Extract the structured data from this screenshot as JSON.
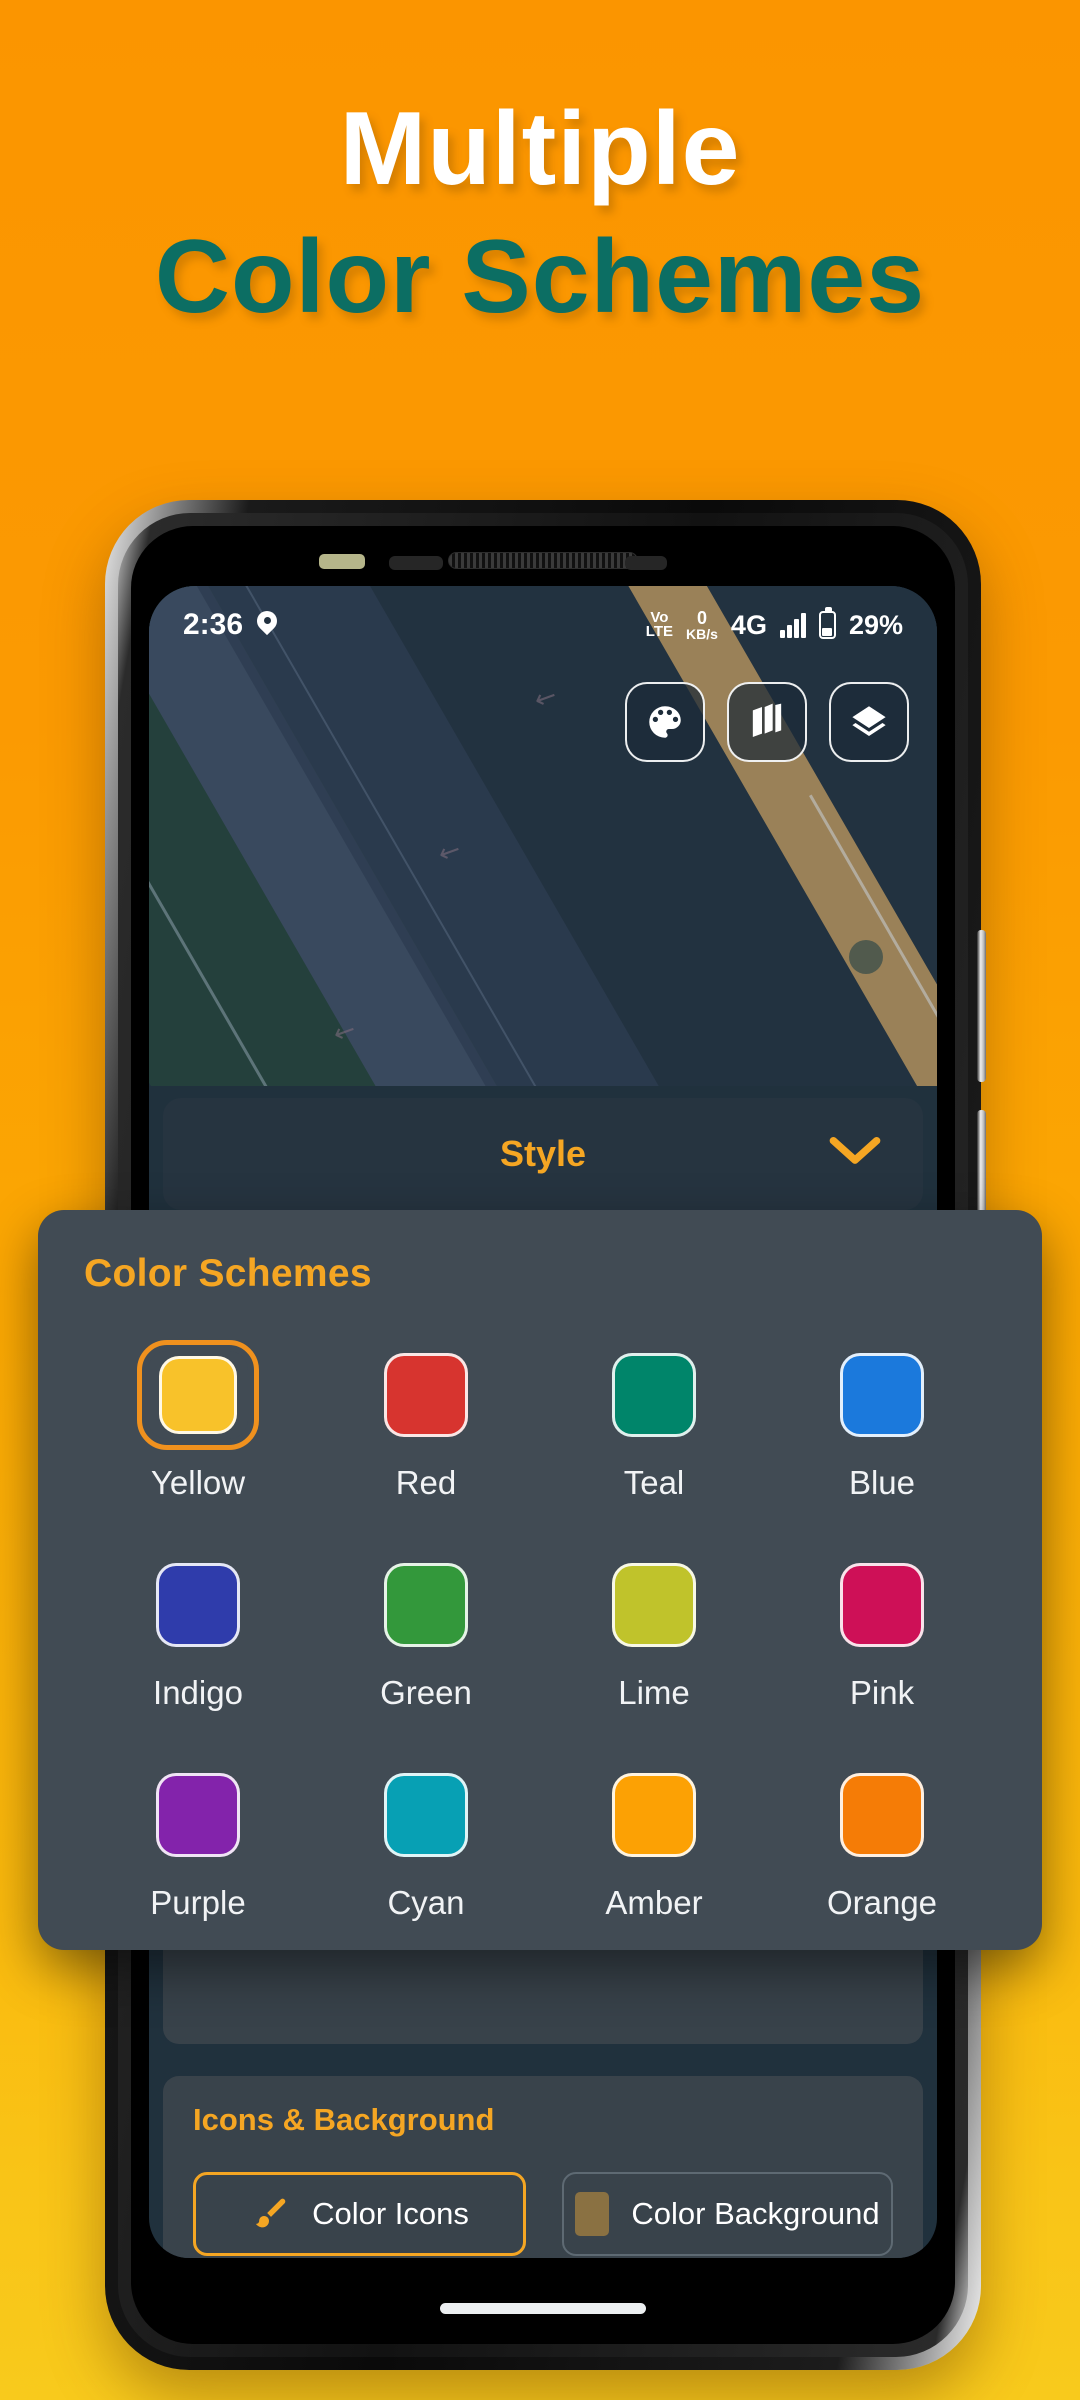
{
  "headline": {
    "line1": "Multiple",
    "line2": "Color Schemes",
    "line1_color": "#FFFFFF",
    "line2_color": "#0C6E63",
    "background_top": "#FB9500",
    "background_bottom": "#F8CA1C"
  },
  "status_bar": {
    "time": "2:36",
    "location_icon": "location-pin-icon",
    "volte_top": "Vo",
    "volte_bottom": "LTE",
    "data_rate_value": "0",
    "data_rate_unit": "KB/s",
    "network": "4G",
    "signal_icon": "signal-bars-icon",
    "battery_icon": "battery-icon",
    "battery_level": "29%"
  },
  "map_controls": [
    {
      "name": "palette-icon",
      "label": "Palette"
    },
    {
      "name": "map-icon",
      "label": "Map"
    },
    {
      "name": "layers-icon",
      "label": "Layers"
    }
  ],
  "style_bar": {
    "label": "Style",
    "label_color": "#F5A623",
    "chevron_icon": "chevron-down-icon"
  },
  "dialog": {
    "title": "Color Schemes",
    "title_color": "#F5A623",
    "background": "#414B54",
    "selected": "Yellow",
    "selection_ring_color": "#F0911E",
    "schemes": [
      {
        "label": "Yellow",
        "color": "#F8C22A",
        "selected": true
      },
      {
        "label": "Red",
        "color": "#D7342F",
        "selected": false
      },
      {
        "label": "Teal",
        "color": "#00856A",
        "selected": false
      },
      {
        "label": "Blue",
        "color": "#1B79DC",
        "selected": false
      },
      {
        "label": "Indigo",
        "color": "#2F3CAB",
        "selected": false
      },
      {
        "label": "Green",
        "color": "#33983B",
        "selected": false
      },
      {
        "label": "Lime",
        "color": "#C0C32B",
        "selected": false
      },
      {
        "label": "Pink",
        "color": "#CE1057",
        "selected": false
      },
      {
        "label": "Purple",
        "color": "#8323AB",
        "selected": false
      },
      {
        "label": "Cyan",
        "color": "#07A0B4",
        "selected": false
      },
      {
        "label": "Amber",
        "color": "#FCA104",
        "selected": false
      },
      {
        "label": "Orange",
        "color": "#F57C06",
        "selected": false
      }
    ]
  },
  "icons_background": {
    "title": "Icons & Background",
    "title_color": "#F5A623",
    "color_icons_label": "Color Icons",
    "color_icons_icon": "paint-brush-icon",
    "color_background_label": "Color Background",
    "color_background_swatch": "#8A7142"
  }
}
